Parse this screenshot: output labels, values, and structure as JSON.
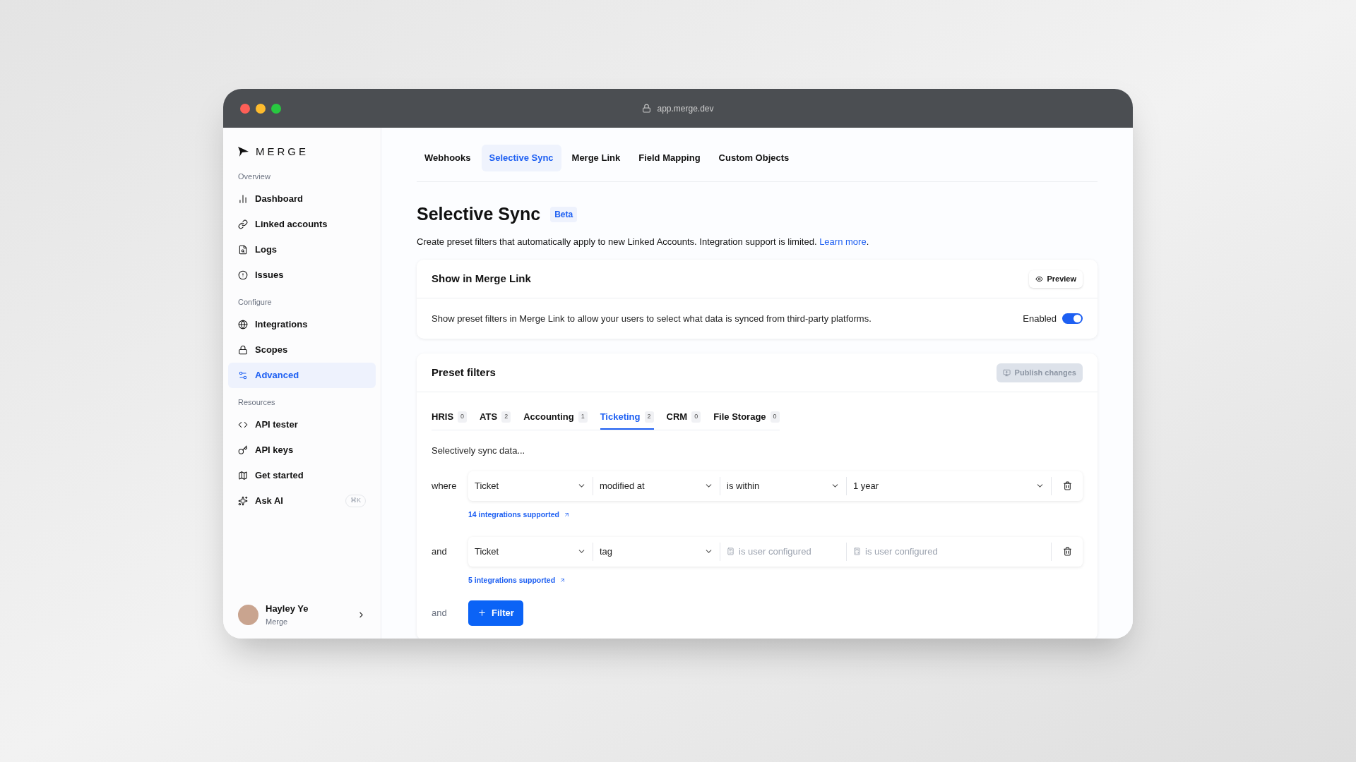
{
  "window": {
    "url": "app.merge.dev"
  },
  "sidebar": {
    "logo": "MERGE",
    "sections": [
      {
        "title": "Overview",
        "items": [
          {
            "label": "Dashboard",
            "selected": false
          },
          {
            "label": "Linked accounts",
            "selected": false
          },
          {
            "label": "Logs",
            "selected": false
          },
          {
            "label": "Issues",
            "selected": false
          }
        ]
      },
      {
        "title": "Configure",
        "items": [
          {
            "label": "Integrations",
            "selected": false
          },
          {
            "label": "Scopes",
            "selected": false
          },
          {
            "label": "Advanced",
            "selected": true
          }
        ]
      },
      {
        "title": "Resources",
        "items": [
          {
            "label": "API tester",
            "selected": false
          },
          {
            "label": "API keys",
            "selected": false
          },
          {
            "label": "Get started",
            "selected": false
          },
          {
            "label": "Ask AI",
            "selected": false,
            "shortcut": "⌘K"
          }
        ]
      }
    ],
    "user": {
      "name": "Hayley Ye",
      "org": "Merge"
    }
  },
  "top_tabs": [
    {
      "label": "Webhooks",
      "selected": false
    },
    {
      "label": "Selective Sync",
      "selected": true
    },
    {
      "label": "Merge Link",
      "selected": false
    },
    {
      "label": "Field Mapping",
      "selected": false
    },
    {
      "label": "Custom Objects",
      "selected": false
    }
  ],
  "page": {
    "title": "Selective Sync",
    "badge": "Beta",
    "description": "Create preset filters that automatically apply to new Linked Accounts. Integration support is limited.",
    "link": "Learn more",
    "description_end": "."
  },
  "merge_link_card": {
    "title": "Show in Merge Link",
    "preview_button": "Preview",
    "text": "Show preset filters in Merge Link to allow your users to select what data is synced from third-party platforms.",
    "toggle": {
      "label": "Enabled",
      "on": true
    }
  },
  "preset_filters": {
    "title": "Preset filters",
    "publish_button": {
      "label": "Publish changes",
      "disabled": true
    },
    "tabs": [
      {
        "label": "HRIS",
        "count": "0",
        "selected": false
      },
      {
        "label": "ATS",
        "count": "2",
        "selected": false
      },
      {
        "label": "Accounting",
        "count": "1",
        "selected": false
      },
      {
        "label": "Ticketing",
        "count": "2",
        "selected": true
      },
      {
        "label": "CRM",
        "count": "0",
        "selected": false
      },
      {
        "label": "File Storage",
        "count": "0",
        "selected": false
      }
    ],
    "intro": "Selectively sync data...",
    "filters": [
      {
        "connector": "where",
        "fields": [
          {
            "kind": "select",
            "value": "Ticket"
          },
          {
            "kind": "select",
            "value": "modified at"
          },
          {
            "kind": "select",
            "value": "is within"
          },
          {
            "kind": "select",
            "value": "1 year"
          }
        ],
        "supported": "14 integrations supported"
      },
      {
        "connector": "and",
        "fields": [
          {
            "kind": "select",
            "value": "Ticket"
          },
          {
            "kind": "select",
            "value": "tag"
          },
          {
            "kind": "user_configured",
            "value": "is user configured"
          },
          {
            "kind": "user_configured",
            "value": "is user configured"
          }
        ],
        "supported": "5 integrations supported"
      }
    ],
    "add": {
      "connector": "and",
      "button": "Filter"
    }
  }
}
